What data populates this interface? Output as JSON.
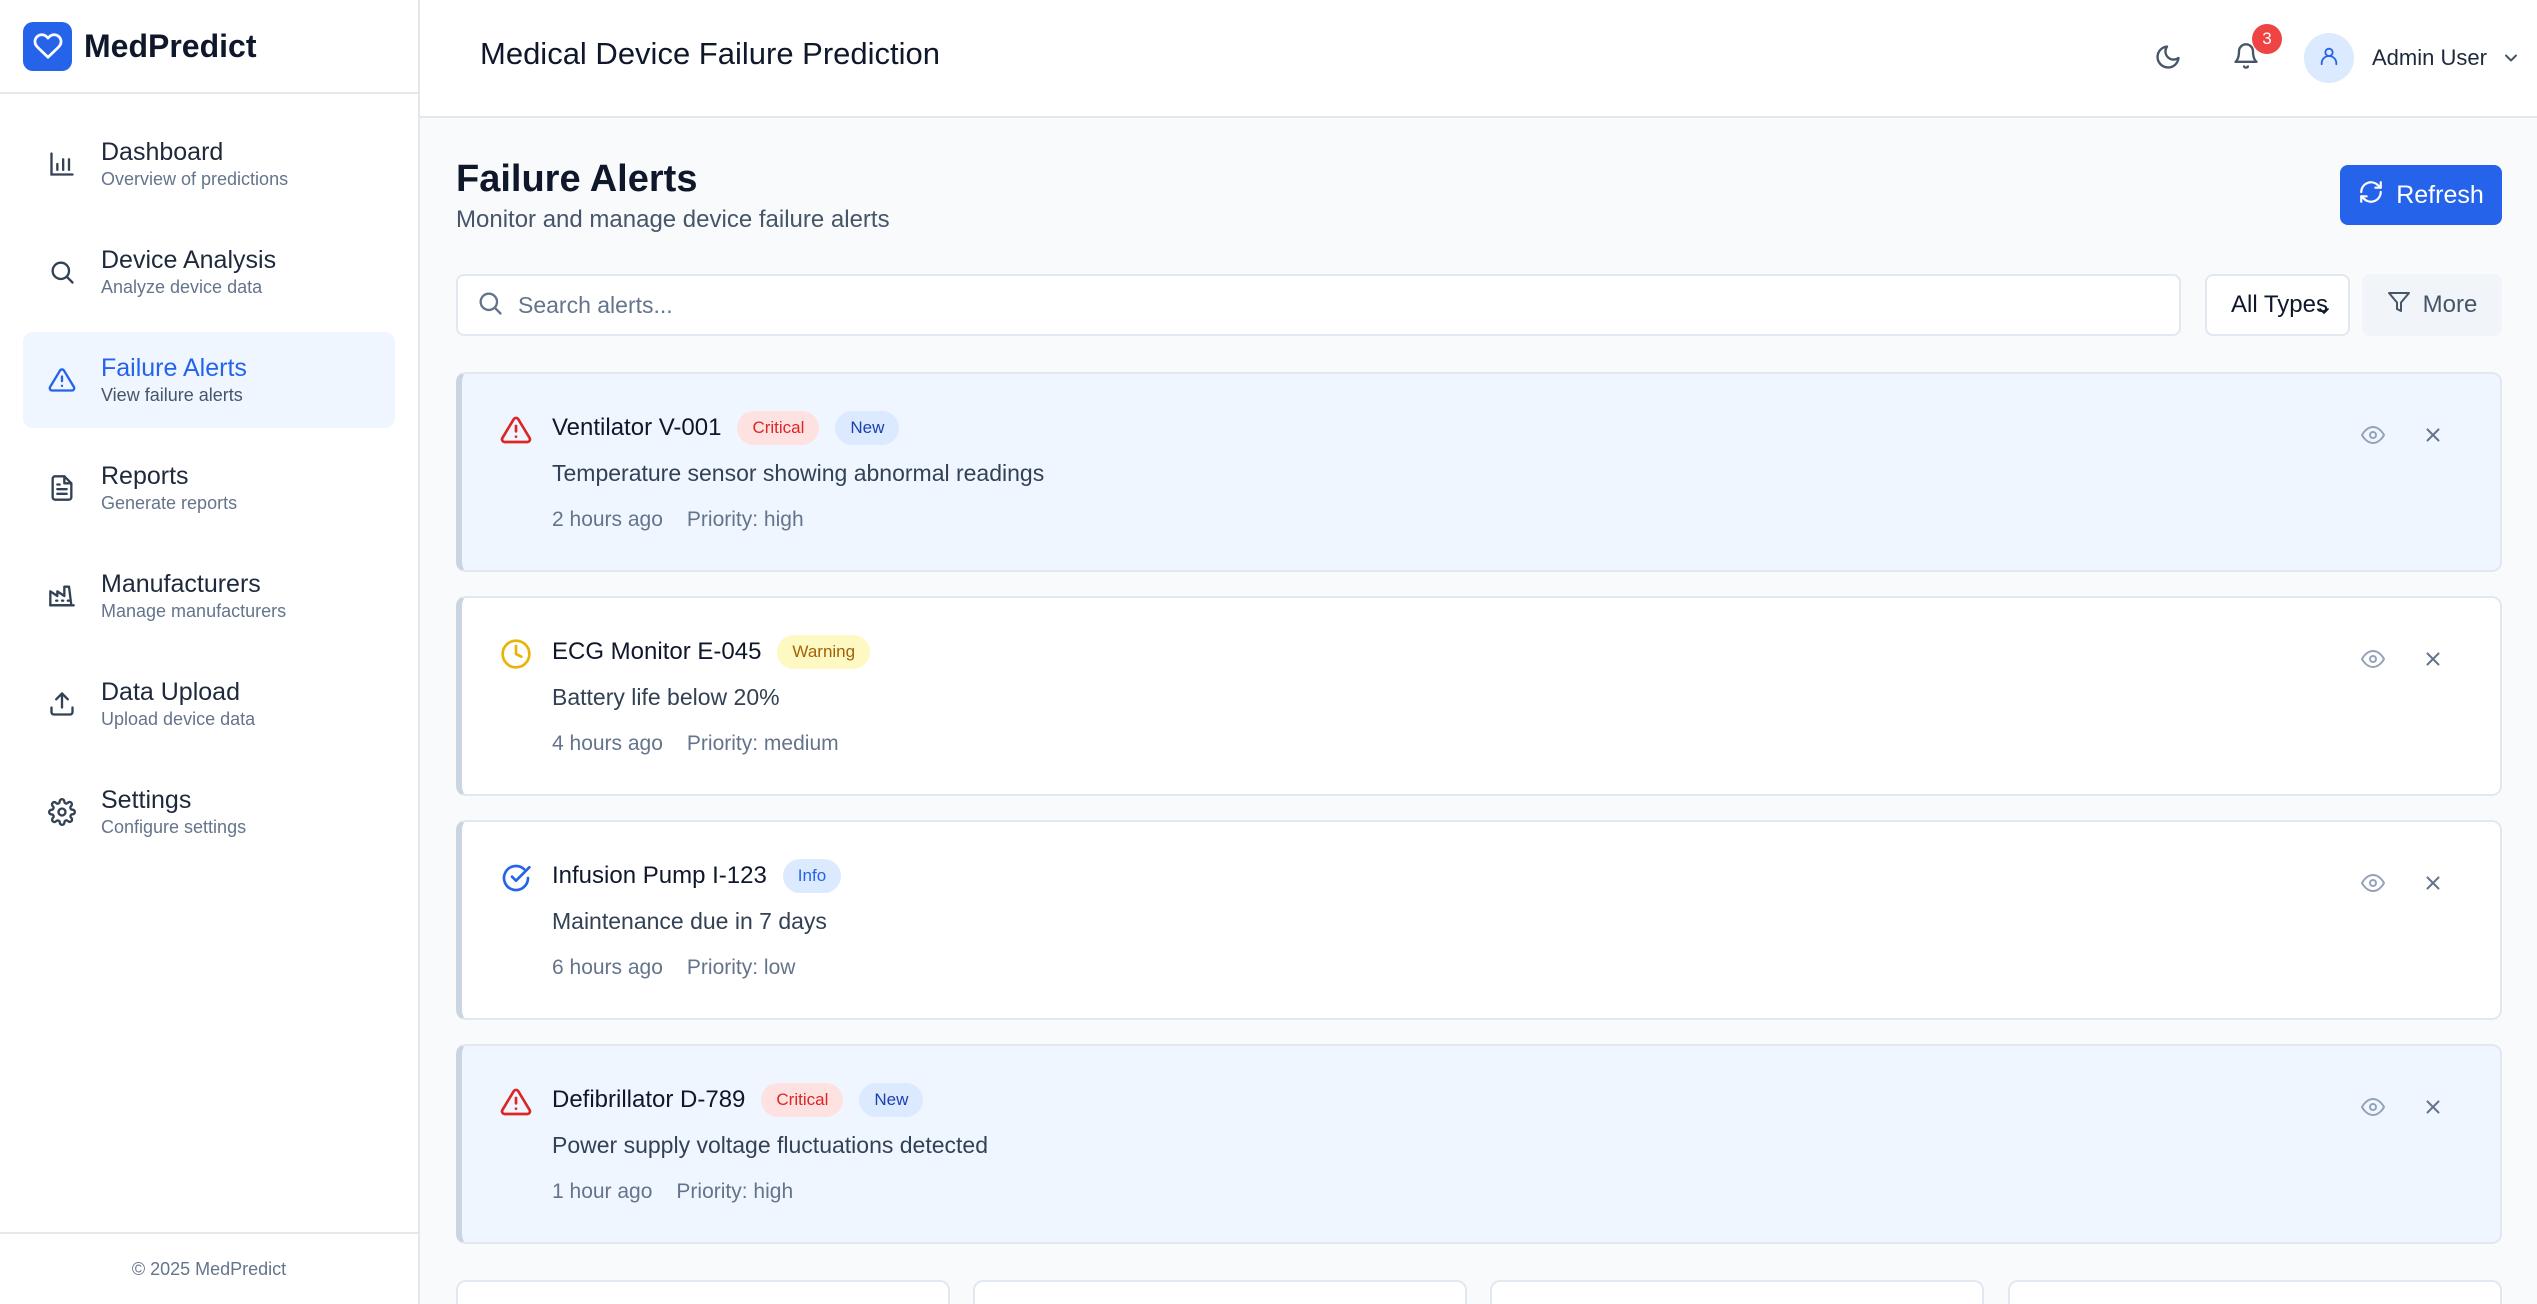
{
  "app": {
    "name": "MedPredict",
    "header_title": "Medical Device Failure Prediction",
    "footer": "© 2025 MedPredict"
  },
  "nav": [
    {
      "label": "Dashboard",
      "sub": "Overview of predictions",
      "icon": "bar-chart-icon",
      "active": false
    },
    {
      "label": "Device Analysis",
      "sub": "Analyze device data",
      "icon": "search-icon",
      "active": false
    },
    {
      "label": "Failure Alerts",
      "sub": "View failure alerts",
      "icon": "alert-triangle-icon",
      "active": true
    },
    {
      "label": "Reports",
      "sub": "Generate reports",
      "icon": "file-text-icon",
      "active": false
    },
    {
      "label": "Manufacturers",
      "sub": "Manage manufacturers",
      "icon": "factory-icon",
      "active": false
    },
    {
      "label": "Data Upload",
      "sub": "Upload device data",
      "icon": "upload-icon",
      "active": false
    },
    {
      "label": "Settings",
      "sub": "Configure settings",
      "icon": "gear-icon",
      "active": false
    }
  ],
  "header": {
    "notification_count": "3",
    "user_name": "Admin User"
  },
  "page": {
    "title": "Failure Alerts",
    "subtitle": "Monitor and manage device failure alerts",
    "refresh_label": "Refresh",
    "search_placeholder": "Search alerts...",
    "type_filter": "All Types",
    "more_label": "More"
  },
  "alerts": [
    {
      "device": "Ventilator V-001",
      "severity": "Critical",
      "new": "New",
      "message": "Temperature sensor showing abnormal readings",
      "time": "2 hours ago",
      "priority": "Priority: high"
    },
    {
      "device": "ECG Monitor E-045",
      "severity": "Warning",
      "new": "",
      "message": "Battery life below 20%",
      "time": "4 hours ago",
      "priority": "Priority: medium"
    },
    {
      "device": "Infusion Pump I-123",
      "severity": "Info",
      "new": "",
      "message": "Maintenance due in 7 days",
      "time": "6 hours ago",
      "priority": "Priority: low"
    },
    {
      "device": "Defibrillator D-789",
      "severity": "Critical",
      "new": "New",
      "message": "Power supply voltage fluctuations detected",
      "time": "1 hour ago",
      "priority": "Priority: high"
    }
  ],
  "colors": {
    "primary": "#2563eb",
    "critical": "#dc2626",
    "warning": "#eab308",
    "info": "#2563eb",
    "unread_bg": "#eff6ff"
  }
}
